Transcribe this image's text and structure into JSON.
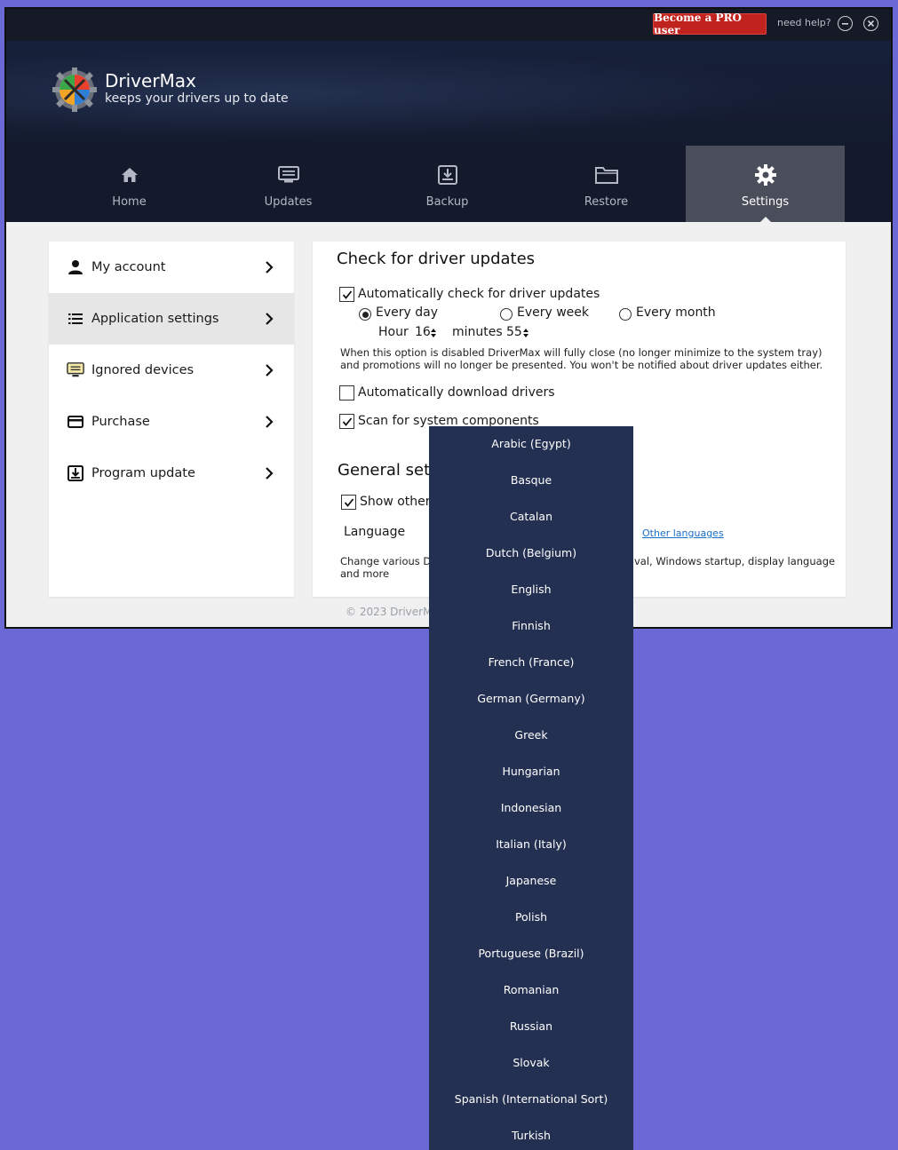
{
  "titlebar": {
    "pro_button": "Become a PRO user",
    "help_link": "need help?",
    "minimize_icon": "minus-circle-icon",
    "close_icon": "x-circle-icon"
  },
  "brand": {
    "name": "DriverMax",
    "tagline": "keeps your drivers up to date"
  },
  "nav": {
    "tabs": [
      {
        "label": "Home",
        "icon": "home-icon"
      },
      {
        "label": "Updates",
        "icon": "monitor-list-icon"
      },
      {
        "label": "Backup",
        "icon": "backup-icon"
      },
      {
        "label": "Restore",
        "icon": "folder-icon"
      },
      {
        "label": "Settings",
        "icon": "gear-icon",
        "active": true
      }
    ]
  },
  "sidebar": {
    "items": [
      {
        "label": "My account",
        "icon": "person-icon"
      },
      {
        "label": "Application settings",
        "icon": "list-icon",
        "active": true
      },
      {
        "label": "Ignored devices",
        "icon": "monitor-icon"
      },
      {
        "label": "Purchase",
        "icon": "card-icon"
      },
      {
        "label": "Program update",
        "icon": "download-icon"
      }
    ]
  },
  "panel": {
    "check_title": "Check for driver updates",
    "auto_check": {
      "label": "Automatically check for driver updates",
      "checked": true
    },
    "frequency": {
      "options": [
        "Every day",
        "Every week",
        "Every month"
      ],
      "selected": "Every day"
    },
    "schedule": {
      "hour_label": "Hour",
      "hour_value": "16",
      "minutes_label": "minutes",
      "minutes_value": "55"
    },
    "note": "When this option is disabled DriverMax will fully close (no longer minimize to the system tray) and promotions will no longer be presented. You won't be notified about driver updates either.",
    "auto_download": {
      "label": "Automatically download drivers",
      "checked": false
    },
    "scan_components": {
      "label": "Scan for system components",
      "checked": true
    },
    "general_title": "General sett",
    "show_other": {
      "label": "Show other",
      "checked": true
    },
    "language_label": "Language",
    "other_languages": "Other languages",
    "general_desc_left_1": "Change various Dri",
    "general_desc_left_2": "and more",
    "general_desc_right": "val, Windows startup, display language"
  },
  "footer": {
    "copyright": "© 2023 DriverMa"
  },
  "language_dropdown": {
    "options": [
      "Arabic (Egypt)",
      "Basque",
      "Catalan",
      "Dutch (Belgium)",
      "English",
      "Finnish",
      "French (France)",
      "German (Germany)",
      "Greek",
      "Hungarian",
      "Indonesian",
      "Italian (Italy)",
      "Japanese",
      "Polish",
      "Portuguese (Brazil)",
      "Romanian",
      "Russian",
      "Slovak",
      "Spanish (International Sort)",
      "Turkish"
    ]
  },
  "colors": {
    "desktop": "#6b69d6",
    "pro_button": "#c0221d",
    "dropdown_bg": "#243052",
    "link": "#1a6fc9"
  }
}
